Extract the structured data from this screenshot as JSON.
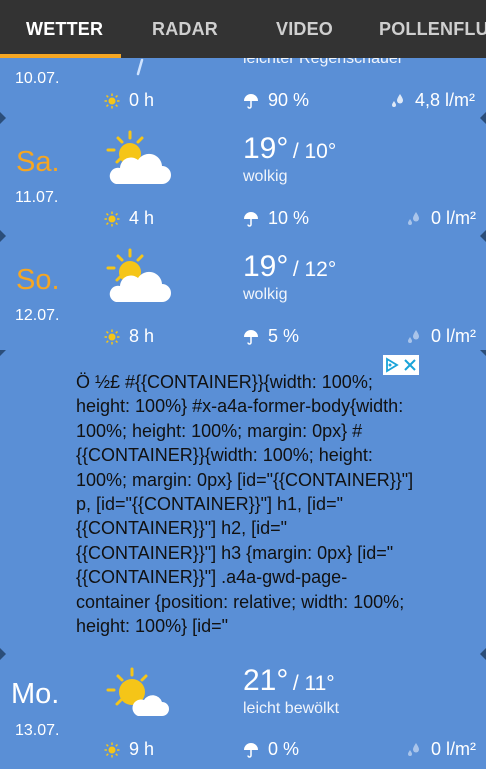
{
  "tabs": [
    {
      "label": "WETTER",
      "active": true
    },
    {
      "label": "RADAR",
      "active": false
    },
    {
      "label": "VIDEO",
      "active": false
    },
    {
      "label": "POLLENFLUG",
      "active": false
    }
  ],
  "colors": {
    "accent": "#f5a623",
    "background": "#5a8fd6",
    "tabbar": "#333333"
  },
  "days": [
    {
      "name": "",
      "date": "10.07.",
      "temp_high": "",
      "temp_low": "",
      "description": "leichter Regenschauer",
      "icon": "rain-shower-icon",
      "sun_hours": "0 h",
      "rain_chance": "90 %",
      "rain_amount": "4,8 l/m²"
    },
    {
      "name": "Sa.",
      "date": "11.07.",
      "temp_high": "19°",
      "temp_low": "/ 10°",
      "description": "wolkig",
      "icon": "partly-cloudy-icon",
      "sun_hours": "4 h",
      "rain_chance": "10 %",
      "rain_amount": "0 l/m²"
    },
    {
      "name": "So.",
      "date": "12.07.",
      "temp_high": "19°",
      "temp_low": "/ 12°",
      "description": "wolkig",
      "icon": "partly-cloudy-icon",
      "sun_hours": "8 h",
      "rain_chance": "5 %",
      "rain_amount": "0 l/m²"
    },
    {
      "name": "Mo.",
      "date": "13.07.",
      "temp_high": "21°",
      "temp_low": "/ 11°",
      "description": "leicht bewölkt",
      "icon": "mostly-sunny-icon",
      "sun_hours": "9 h",
      "rain_chance": "0 %",
      "rain_amount": "0 l/m²"
    }
  ],
  "ad": {
    "text": "Ö  ½£ #{{CONTAINER}}{width: 100%; height: 100%} #x-a4a-former-body{width: 100%; height: 100%; margin: 0px} #{{CONTAINER}}{width: 100%; height: 100%; margin: 0px} [id=\"{{CONTAINER}}\"] p, [id=\"{{CONTAINER}}\"] h1, [id=\"{{CONTAINER}}\"] h2, [id=\"{{CONTAINER}}\"] h3 {margin: 0px} [id=\"{{CONTAINER}}\"] .a4a-gwd-page-container {position: relative; width: 100%; height: 100%} [id=\""
  }
}
